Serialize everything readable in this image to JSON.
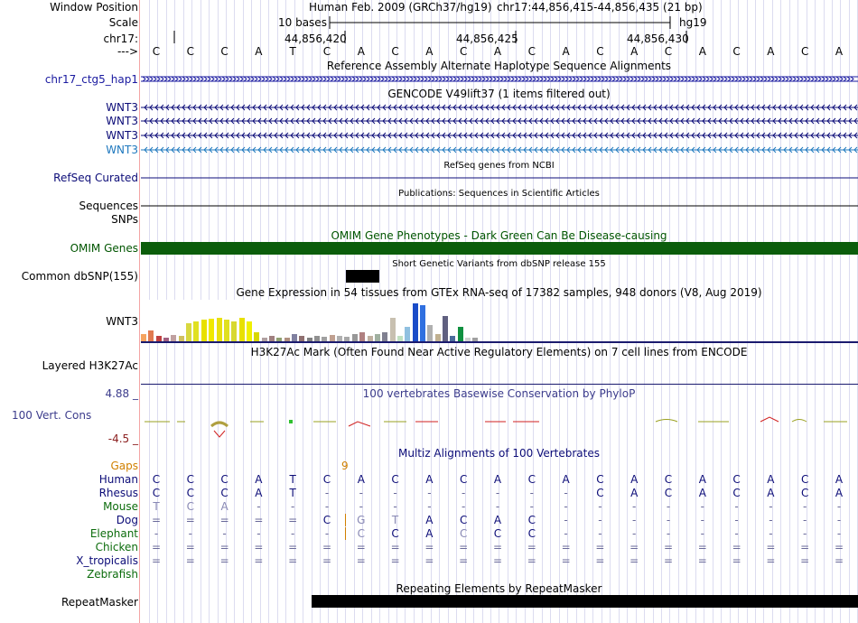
{
  "header": {
    "window_position_label": "Window Position",
    "scale_label": "Scale",
    "chrom_label": "chr17:",
    "arrow_label": "--->",
    "assembly_title": "Human Feb. 2009 (GRCh37/hg19)",
    "position_text": "chr17:44,856,415-44,856,435 (21 bp)",
    "scale_text": "10 bases",
    "db_text": "hg19",
    "coords": [
      "44,856,420",
      "44,856,425",
      "44,856,430"
    ],
    "bases": [
      "C",
      "C",
      "C",
      "A",
      "T",
      "C",
      "A",
      "C",
      "A",
      "C",
      "A",
      "C",
      "A",
      "C",
      "A",
      "C",
      "A",
      "C",
      "A",
      "C",
      "A"
    ]
  },
  "tracks": {
    "haplotype": {
      "label": "chr17_ctg5_hap1",
      "title": "Reference Assembly Alternate Haplotype Sequence Alignments",
      "color": "#1a1aa0"
    },
    "gencode": {
      "title": "GENCODE V49lift37 (1 items filtered out)",
      "items": [
        "WNT3",
        "WNT3",
        "WNT3",
        "WNT3"
      ],
      "color": "#0c0c78",
      "last_color": "#1e78be"
    },
    "refseq": {
      "label": "RefSeq Curated",
      "title": "RefSeq genes from NCBI",
      "color": "#0c0c78"
    },
    "publications": {
      "label": "Sequences",
      "title": "Publications: Sequences in Scientific Articles"
    },
    "snps": {
      "label": "SNPs"
    },
    "omim": {
      "label": "OMIM Genes",
      "title": "OMIM Gene Phenotypes - Dark Green Can Be Disease-causing",
      "color": "#005500",
      "bar_color": "#0b5d0b"
    },
    "dbsnp": {
      "label": "Common dbSNP(155)",
      "title": "Short Genetic Variants from dbSNP release 155"
    },
    "gtex": {
      "label": "WNT3",
      "title": "Gene Expression in 54 tissues from GTEx RNA-seq of 17382 samples, 948 donors (V8, Aug 2019)"
    },
    "h3k27ac": {
      "label": "Layered H3K27Ac",
      "title": "H3K27Ac Mark (Often Found Near Active Regulatory Elements) on 7 cell lines from ENCODE"
    },
    "phylop": {
      "label": "100 Vert. Cons",
      "title": "100 vertebrates Basewise Conservation by PhyloP",
      "max": "4.88 _",
      "min": "-4.5 _",
      "color": "#3c3c8c",
      "min_color": "#8c2020"
    },
    "multiz": {
      "title": "Multiz Alignments of 100 Vertebrates",
      "gaps_label": "Gaps",
      "gap_count": "9",
      "gaps_color": "#d08000",
      "species": [
        {
          "name": "Human",
          "color": "#0c0c78",
          "seq": [
            "C",
            "C",
            "C",
            "A",
            "T",
            "C",
            "A",
            "C",
            "A",
            "C",
            "A",
            "C",
            "A",
            "C",
            "A",
            "C",
            "A",
            "C",
            "A",
            "C",
            "A"
          ]
        },
        {
          "name": "Rhesus",
          "color": "#0c0c78",
          "seq": [
            "C",
            "C",
            "C",
            "A",
            "T",
            "-",
            "-",
            "-",
            "-",
            "-",
            "-",
            "-",
            "-",
            "C",
            "A",
            "C",
            "A",
            "C",
            "A",
            "C",
            "A"
          ]
        },
        {
          "name": "Mouse",
          "color": "#0c6c0c",
          "seq": [
            "T",
            "C",
            "A",
            "-",
            "-",
            "-",
            "-",
            "-",
            "-",
            "-",
            "-",
            "-",
            "-",
            "-",
            "-",
            "-",
            "-",
            "-",
            "-",
            "-",
            "-"
          ]
        },
        {
          "name": "Dog",
          "color": "#0c0c78",
          "seq": [
            "=",
            "=",
            "=",
            "=",
            "=",
            "C",
            "G",
            "T",
            "A",
            "C",
            "A",
            "C",
            "-",
            "-",
            "-",
            "-",
            "-",
            "-",
            "-",
            "-",
            "-"
          ]
        },
        {
          "name": "Elephant",
          "color": "#0c6c0c",
          "seq": [
            "-",
            "-",
            "-",
            "-",
            "-",
            "-",
            "C",
            "C",
            "A",
            "C",
            "C",
            "C",
            "-",
            "-",
            "-",
            "-",
            "-",
            "-",
            "-",
            "-",
            "-"
          ]
        },
        {
          "name": "Chicken",
          "color": "#0c6c0c",
          "seq": [
            "=",
            "=",
            "=",
            "=",
            "=",
            "=",
            "=",
            "=",
            "=",
            "=",
            "=",
            "=",
            "=",
            "=",
            "=",
            "=",
            "=",
            "=",
            "=",
            "=",
            "="
          ]
        },
        {
          "name": "X_tropicalis",
          "color": "#0c0c78",
          "seq": [
            "=",
            "=",
            "=",
            "=",
            "=",
            "=",
            "=",
            "=",
            "=",
            "=",
            "=",
            "=",
            "=",
            "=",
            "=",
            "=",
            "=",
            "=",
            "=",
            "=",
            "="
          ]
        },
        {
          "name": "Zebrafish",
          "color": "#0c6c0c",
          "seq": []
        }
      ]
    },
    "repeatmasker": {
      "label": "RepeatMasker",
      "title": "Repeating Elements by RepeatMasker"
    }
  }
}
